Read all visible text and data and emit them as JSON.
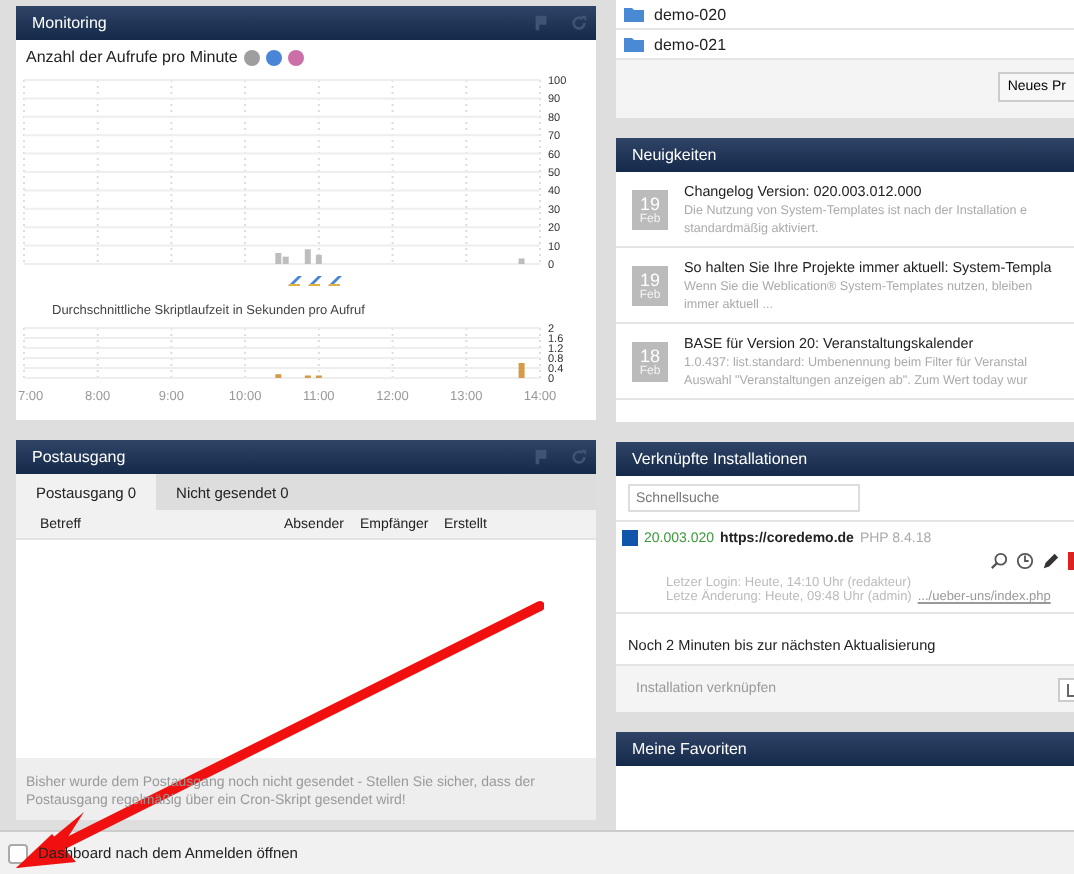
{
  "monitoring": {
    "title": "Monitoring",
    "calls": {
      "title": "Anzahl der Aufrufe pro Minute",
      "legend": [
        {
          "color": "#9e9e9e"
        },
        {
          "color": "#4a86d8"
        },
        {
          "color": "#cc6fa8"
        }
      ],
      "chart_data": {
        "type": "bar",
        "x": [
          10.45,
          10.55,
          10.85,
          11.0,
          13.75
        ],
        "grid": true,
        "series": [
          {
            "color": "#bdbdbd",
            "values": [
              6,
              4,
              8,
              5,
              3
            ]
          }
        ],
        "xlim": [
          7,
          14
        ],
        "ylim": [
          0,
          100
        ],
        "yticks": [
          0,
          10,
          20,
          30,
          40,
          50,
          60,
          70,
          80,
          90,
          100
        ]
      }
    },
    "runtime": {
      "title": "Durchschnittliche Skriptlaufzeit in Sekunden pro Aufruf",
      "chart_data": {
        "type": "bar",
        "x": [
          10.45,
          10.85,
          11.0,
          13.75
        ],
        "grid": true,
        "series": [
          {
            "color": "#d59a4a",
            "values": [
              0.15,
              0.1,
              0.1,
              0.6
            ]
          }
        ],
        "xlim": [
          7,
          14
        ],
        "ylim": [
          0,
          2
        ],
        "yticks": [
          0,
          0.4,
          0.8,
          1.2,
          1.6,
          2
        ],
        "xticks": [
          {
            "value": 7,
            "label": "7:00"
          },
          {
            "value": 8,
            "label": "8:00"
          },
          {
            "value": 9,
            "label": "9:00"
          },
          {
            "value": 10,
            "label": "10:00"
          },
          {
            "value": 11,
            "label": "11:00"
          },
          {
            "value": 12,
            "label": "12:00"
          },
          {
            "value": 13,
            "label": "13:00"
          },
          {
            "value": 14,
            "label": "14:00"
          }
        ]
      }
    }
  },
  "outbox": {
    "title": "Postausgang",
    "tabs": [
      {
        "label": "Postausgang 0",
        "selected": true
      },
      {
        "label": "Nicht gesendet 0",
        "selected": false
      }
    ],
    "columns": [
      "Betreff",
      "Absender",
      "Empfänger",
      "Erstellt"
    ],
    "note": "Bisher wurde dem Postausgang noch nicht gesendet - Stellen Sie sicher, dass der Postausgang regelmäßig über ein Cron-Skript gesendet wird!"
  },
  "projects": {
    "items": [
      "demo-020",
      "demo-021"
    ],
    "button": "Neues Pr"
  },
  "news": {
    "title": "Neuigkeiten",
    "items": [
      {
        "day": "19",
        "month": "Feb",
        "title": "Changelog Version: 020.003.012.000",
        "text": [
          "Die Nutzung von System-Templates ist nach der Installation e",
          "standardmäßig aktiviert."
        ]
      },
      {
        "day": "19",
        "month": "Feb",
        "title": "So halten Sie Ihre Projekte immer aktuell: System-Templa",
        "text": [
          "Wenn Sie die Weblication® System-Templates nutzen, bleiben",
          "immer aktuell ..."
        ]
      },
      {
        "day": "18",
        "month": "Feb",
        "title": "BASE für Version 20: Veranstaltungskalender",
        "text": [
          "1.0.437: list.standard: Umbenennung beim Filter für Veranstal",
          "Auswahl \"Veranstaltungen anzeigen ab\". Zum Wert today wur"
        ]
      }
    ]
  },
  "installations": {
    "title": "Verknüpfte Installationen",
    "search_placeholder": "Schnellsuche",
    "items": [
      {
        "color": "#1155aa",
        "version": "20.003.020",
        "url": "https://coredemo.de",
        "php": "PHP 8.4.18",
        "login": "Letzer Login: Heute, 14:10 Uhr (redakteur)",
        "change": "Letze Änderung: Heute, 09:48 Uhr (admin)",
        "link": ".../ueber-uns/index.php"
      }
    ],
    "refresh": "Noch 2 Minuten bis zur nächsten Aktualisierung",
    "link_label": "Installation verknüpfen"
  },
  "favorites": {
    "title": "Meine Favoriten"
  },
  "footer": {
    "label": "Dashboard nach dem Anmelden öffnen",
    "checked": false
  }
}
